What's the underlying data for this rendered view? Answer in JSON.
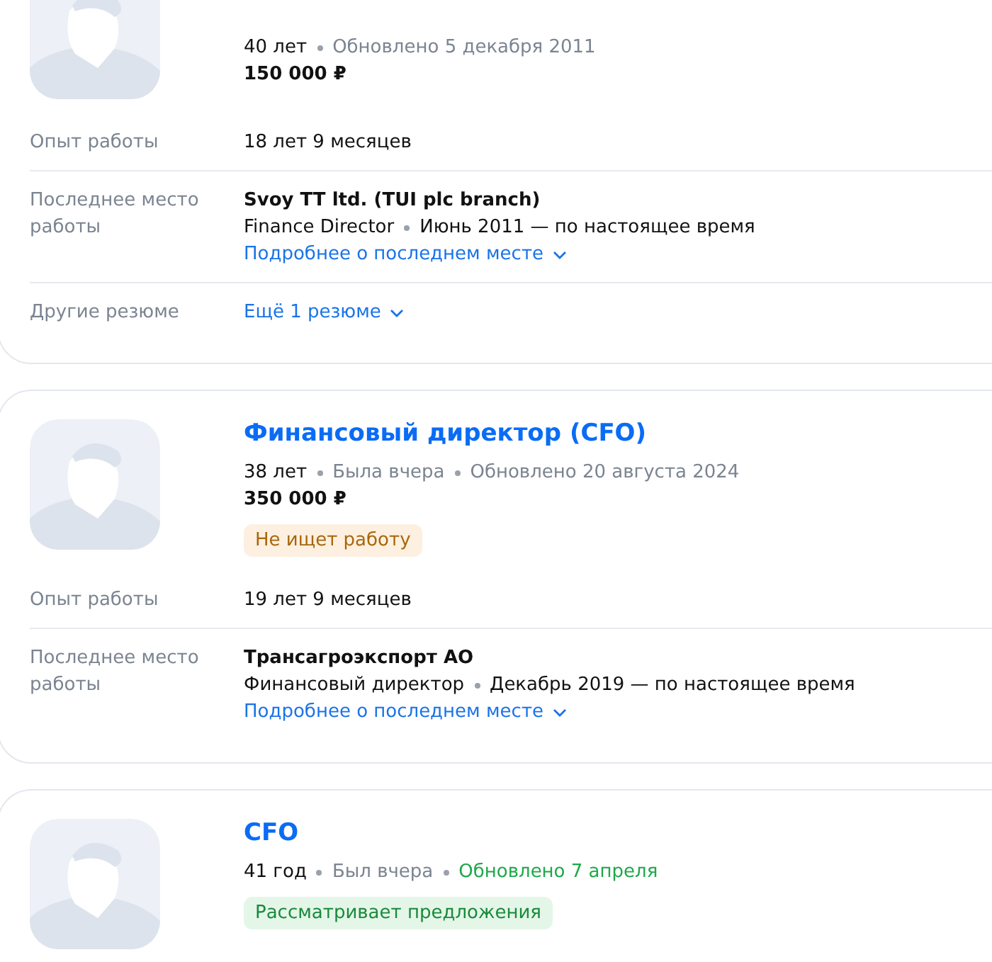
{
  "cards": [
    {
      "meta": [
        {
          "text": "40 лет",
          "kind": "plain"
        },
        {
          "text": "Обновлено 5 декабря 2011",
          "kind": "muted"
        }
      ],
      "salary": "150 000 ₽",
      "rows": [
        {
          "label": "Опыт работы",
          "kind": "text",
          "value": "18 лет 9 месяцев"
        },
        {
          "label": "Последнее место работы",
          "kind": "job",
          "company": "Svoy TT ltd. (TUI plc branch)",
          "position": "Finance Director",
          "period": "Июнь 2011 — по настоящее время",
          "link": "Подробнее о последнем месте"
        },
        {
          "label": "Другие резюме",
          "kind": "link",
          "link": "Ещё 1 резюме"
        }
      ]
    },
    {
      "title": "Финансовый директор (CFO)",
      "meta": [
        {
          "text": "38 лет",
          "kind": "plain"
        },
        {
          "text": "Была вчера",
          "kind": "muted"
        },
        {
          "text": "Обновлено 20 августа 2024",
          "kind": "muted"
        }
      ],
      "salary": "350 000 ₽",
      "status": {
        "text": "Не ищет работу",
        "kind": "not_looking"
      },
      "rows": [
        {
          "label": "Опыт работы",
          "kind": "text",
          "value": "19 лет 9 месяцев"
        },
        {
          "label": "Последнее место работы",
          "kind": "job",
          "company": "Трансагроэкспорт АО",
          "position": "Финансовый директор",
          "period": "Декабрь 2019 — по настоящее время",
          "link": "Подробнее о последнем месте"
        }
      ]
    },
    {
      "title": "CFO",
      "meta": [
        {
          "text": "41 год",
          "kind": "plain"
        },
        {
          "text": "Был вчера",
          "kind": "muted"
        },
        {
          "text": "Обновлено 7 апреля",
          "kind": "fresh"
        }
      ],
      "status": {
        "text": "Рассматривает предложения",
        "kind": "open"
      }
    }
  ]
}
